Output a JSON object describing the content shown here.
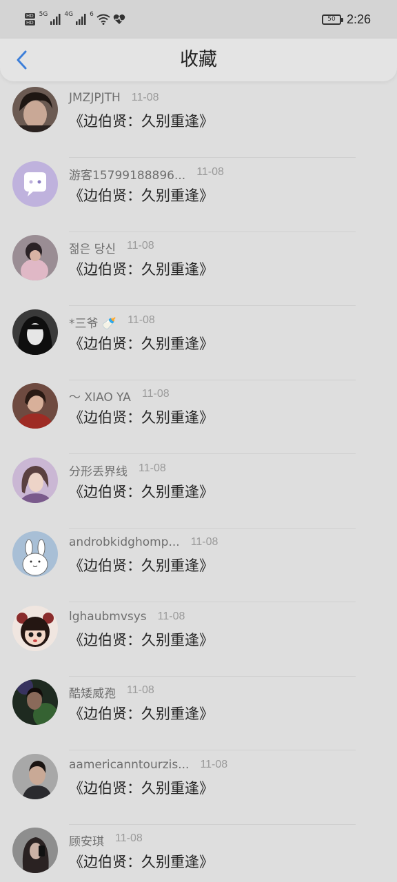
{
  "status_bar": {
    "sim1": "HD",
    "sim2": "HD",
    "net1": "5G",
    "net2": "4G",
    "wifi_label": "6",
    "battery": "50",
    "time": "2:26"
  },
  "nav": {
    "back_icon": "chevron-left-icon",
    "title": "收藏"
  },
  "colors": {
    "accent": "#3d7fd9",
    "background": "#dedede"
  },
  "items": [
    {
      "username": "JMZJPJTH",
      "date": "11-08",
      "content": "《边伯贤：久别重逢》",
      "avatar": "photo-dark-hair"
    },
    {
      "username": "游客15799188896...",
      "date": "11-08",
      "content": "《边伯贤：久别重逢》",
      "avatar": "default-chat-bubble"
    },
    {
      "username": "젊은 당신",
      "date": "11-08",
      "content": "《边伯贤：久别重逢》",
      "avatar": "photo-pink-sweater"
    },
    {
      "username": "*三爷 🍼",
      "date": "11-08",
      "content": "《边伯贤：久别重逢》",
      "avatar": "photo-monochrome-girl"
    },
    {
      "username": "～ XIAO YA",
      "date": "11-08",
      "content": "《边伯贤：久别重逢》",
      "avatar": "photo-red-outfit"
    },
    {
      "username": "分形丢界线",
      "date": "11-08",
      "content": "《边伯贤：久别重逢》",
      "avatar": "photo-purple-girl"
    },
    {
      "username": "androbkidghomp...",
      "date": "11-08",
      "content": "《边伯贤：久别重逢》",
      "avatar": "cartoon-rabbit"
    },
    {
      "username": "lghaubmvsys",
      "date": "11-08",
      "content": "《边伯贤：久别重逢》",
      "avatar": "cartoon-girl"
    },
    {
      "username": "酷矮威孢",
      "date": "11-08",
      "content": "《边伯贤：久别重逢》",
      "avatar": "photo-green-light"
    },
    {
      "username": "aamericanntourzis...",
      "date": "11-08",
      "content": "《边伯贤：久别重逢》",
      "avatar": "photo-man-dark"
    },
    {
      "username": "顾安琪",
      "date": "11-08",
      "content": "《边伯贤：久别重逢》",
      "avatar": "photo-girl-phone"
    }
  ]
}
